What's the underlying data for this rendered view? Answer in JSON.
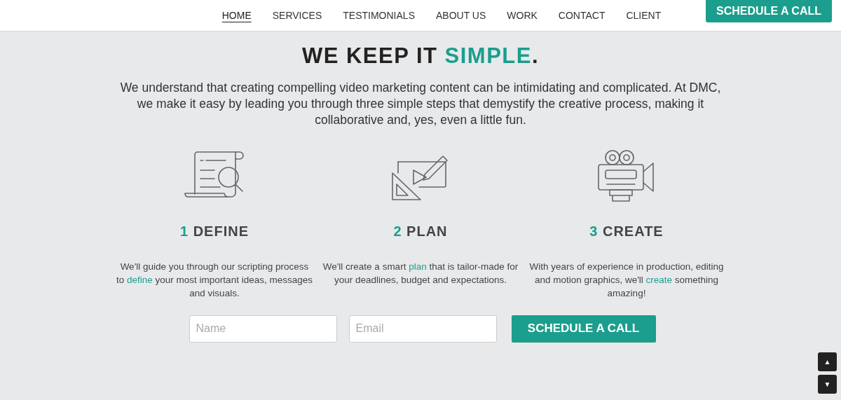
{
  "nav": {
    "items": [
      {
        "label": "HOME",
        "selected": true
      },
      {
        "label": "SERVICES",
        "selected": false
      },
      {
        "label": "TESTIMONIALS",
        "selected": false
      },
      {
        "label": "ABOUT US",
        "selected": false
      },
      {
        "label": "WORK",
        "selected": false
      },
      {
        "label": "CONTACT",
        "selected": false
      },
      {
        "label": "CLIENT",
        "selected": false
      }
    ],
    "cta": "SCHEDULE A CALL"
  },
  "heading": {
    "before": "WE KEEP IT ",
    "accent": "SIMPLE",
    "after": "."
  },
  "intro": "We understand that creating compelling video marketing content can be intimidating and complicated. At DMC, we make it easy by leading you through three simple steps that demystify the creative process, making it collaborative and, yes, even a little fun.",
  "steps": [
    {
      "kind": "script",
      "number": "1",
      "title": "DEFINE",
      "before": "We'll guide you through our scripting process to ",
      "link": "define",
      "after": " your most important ideas, messages and visuals."
    },
    {
      "kind": "plan",
      "number": "2",
      "title": "PLAN",
      "before": "We'll create a smart ",
      "link": "plan",
      "after": " that is tailor-made for your deadlines, budget and expectations."
    },
    {
      "kind": "camera",
      "number": "3",
      "title": "CREATE",
      "before": "With years of experience in production, editing and motion graphics, we'll ",
      "link": "create",
      "after": " something amazing!"
    }
  ],
  "form": {
    "name_placeholder": "Name",
    "email_placeholder": "Email",
    "button": "SCHEDULE A CALL"
  },
  "scroll": {
    "up": "▲",
    "down": "▼"
  }
}
